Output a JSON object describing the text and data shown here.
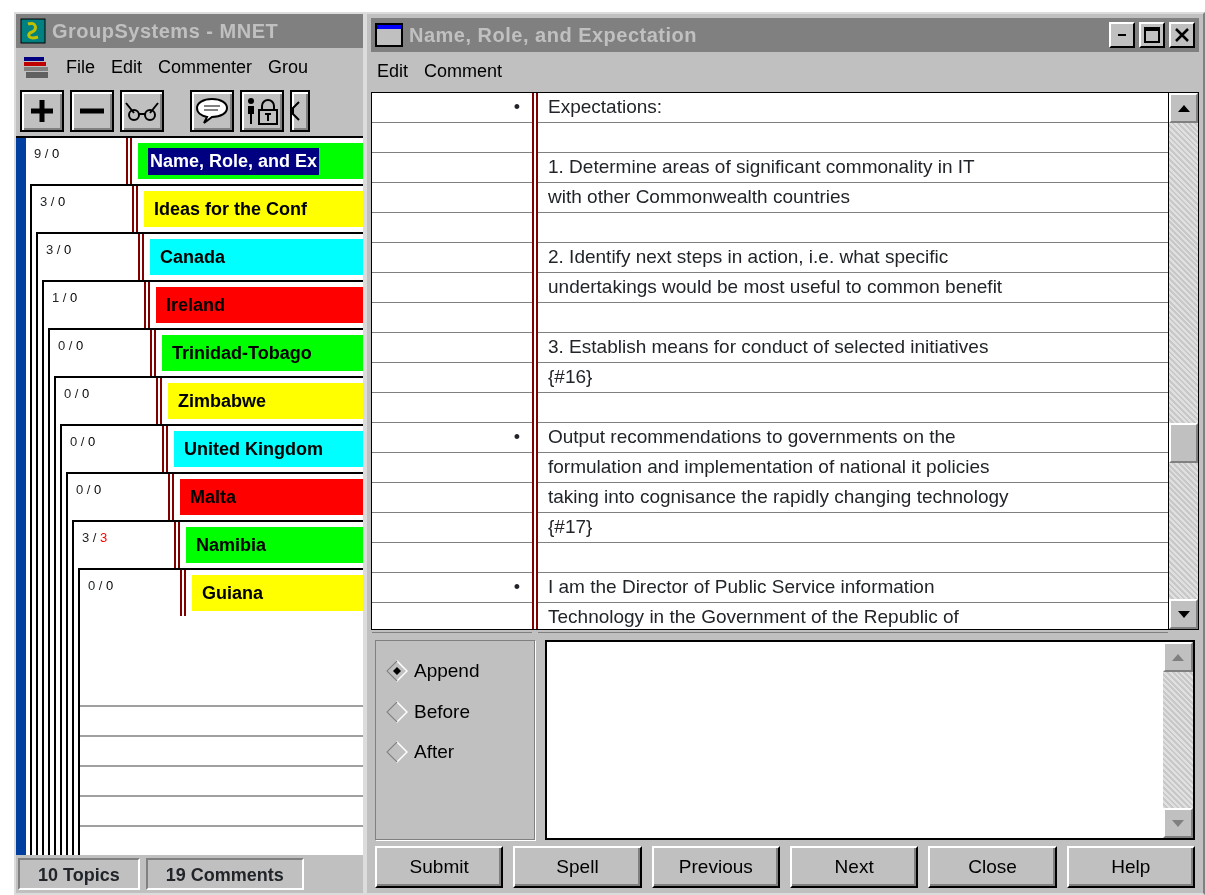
{
  "main_window": {
    "title": "GroupSystems - MNET",
    "menu": [
      "File",
      "Edit",
      "Commenter",
      "Grou"
    ],
    "topics": [
      {
        "count": "9 /",
        "new": "0",
        "unread": false,
        "title": "Name, Role, and Ex",
        "color": "#00ff00",
        "selected": true
      },
      {
        "count": "3 /",
        "new": "0",
        "unread": false,
        "title": "Ideas for the Conf",
        "color": "#ffff00",
        "selected": false
      },
      {
        "count": "3 /",
        "new": "0",
        "unread": false,
        "title": "Canada",
        "color": "#00ffff",
        "selected": false
      },
      {
        "count": "1 /",
        "new": "0",
        "unread": false,
        "title": "Ireland",
        "color": "#ff0000",
        "selected": false
      },
      {
        "count": "0 /",
        "new": "0",
        "unread": false,
        "title": "Trinidad-Tobago",
        "color": "#00ff00",
        "selected": false
      },
      {
        "count": "0 /",
        "new": "0",
        "unread": false,
        "title": "Zimbabwe",
        "color": "#ffff00",
        "selected": false
      },
      {
        "count": "0 /",
        "new": "0",
        "unread": false,
        "title": "United Kingdom",
        "color": "#00ffff",
        "selected": false
      },
      {
        "count": "0 /",
        "new": "0",
        "unread": false,
        "title": "Malta",
        "color": "#ff0000",
        "selected": false
      },
      {
        "count": "3 /",
        "new": "3",
        "unread": true,
        "title": "Namibia",
        "color": "#00ff00",
        "selected": false
      },
      {
        "count": "0 /",
        "new": "0",
        "unread": false,
        "title": "Guiana",
        "color": "#ffff00",
        "selected": false
      }
    ],
    "status_bar": [
      "10 Topics",
      "19 Comments"
    ]
  },
  "comment_window": {
    "title": "Name, Role, and Expectation",
    "menu": [
      "Edit",
      "Comment"
    ],
    "lines": [
      {
        "kind": "text",
        "bullet": true,
        "text": "Expectations:"
      },
      {
        "kind": "blank"
      },
      {
        "kind": "text",
        "bullet": false,
        "text": "1. Determine areas of significant commonality in IT"
      },
      {
        "kind": "text",
        "bullet": false,
        "text": "with other Commonwealth countries"
      },
      {
        "kind": "blank"
      },
      {
        "kind": "text",
        "bullet": false,
        "text": "2. Identify next steps in action, i.e. what specific"
      },
      {
        "kind": "text",
        "bullet": false,
        "text": "undertakings would be most useful to common benefit"
      },
      {
        "kind": "blank"
      },
      {
        "kind": "text",
        "bullet": false,
        "text": "3. Establish means for conduct of selected initiatives"
      },
      {
        "kind": "text",
        "bullet": false,
        "text": "{#16}"
      },
      {
        "kind": "blank"
      },
      {
        "kind": "text",
        "bullet": true,
        "text": "Output recommendations to governments on the"
      },
      {
        "kind": "text",
        "bullet": false,
        "text": "formulation and implementation of national it policies"
      },
      {
        "kind": "text",
        "bullet": false,
        "text": "taking into cognisance the rapidly changing technology"
      },
      {
        "kind": "text",
        "bullet": false,
        "text": "{#17}"
      },
      {
        "kind": "blank"
      },
      {
        "kind": "text",
        "bullet": true,
        "text": "I am the Director of Public Service information"
      },
      {
        "kind": "text",
        "bullet": false,
        "text": "Technology in the Government of the Republic of"
      }
    ],
    "bullet_mark": "•",
    "insert_options": [
      {
        "label": "Append",
        "selected": true
      },
      {
        "label": "Before",
        "selected": false
      },
      {
        "label": "After",
        "selected": false
      }
    ],
    "buttons": [
      "Submit",
      "Spell",
      "Previous",
      "Next",
      "Close",
      "Help"
    ]
  }
}
